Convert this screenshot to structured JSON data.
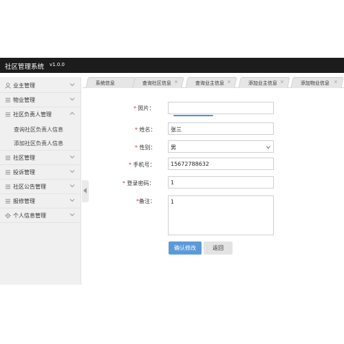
{
  "app": {
    "title": "社区管理系统",
    "version": "v1.0.0"
  },
  "sidebar": {
    "items": [
      {
        "label": "业主管理",
        "icon": "user-icon"
      },
      {
        "label": "物业管理",
        "icon": "list-icon"
      },
      {
        "label": "社区负责人管理",
        "icon": "list-icon",
        "expanded": true,
        "children": [
          {
            "label": "查询社区负责人信息"
          },
          {
            "label": "添加社区负责人信息"
          }
        ]
      },
      {
        "label": "社区管理",
        "icon": "list-icon"
      },
      {
        "label": "投诉管理",
        "icon": "list-icon"
      },
      {
        "label": "社区公告管理",
        "icon": "list-icon"
      },
      {
        "label": "报修管理",
        "icon": "list-icon"
      },
      {
        "label": "个人信息管理",
        "icon": "gear-icon"
      }
    ]
  },
  "tabs": [
    {
      "label": "系统信息",
      "closable": false
    },
    {
      "label": "查询社区信息",
      "closable": true
    },
    {
      "label": "查询业主信息",
      "closable": true
    },
    {
      "label": "添加业主信息",
      "closable": true
    },
    {
      "label": "添加物业信息",
      "closable": true
    }
  ],
  "tab_close_glyph": "×",
  "form": {
    "required_mark": "*",
    "photo": {
      "label": "照片：",
      "value": ""
    },
    "name": {
      "label": "姓名：",
      "value": "张三"
    },
    "gender": {
      "label": "性别：",
      "value": "男"
    },
    "phone": {
      "label": "手机号：",
      "value": "15672788632"
    },
    "password": {
      "label": "登录密码：",
      "value": "1"
    },
    "remark": {
      "label": "备注：",
      "value": "1"
    }
  },
  "buttons": {
    "confirm": "确认修改",
    "back": "返回"
  },
  "colors": {
    "header_bg": "#1c1c1c",
    "primary": "#5b9ad8",
    "required": "#e02d2d"
  }
}
